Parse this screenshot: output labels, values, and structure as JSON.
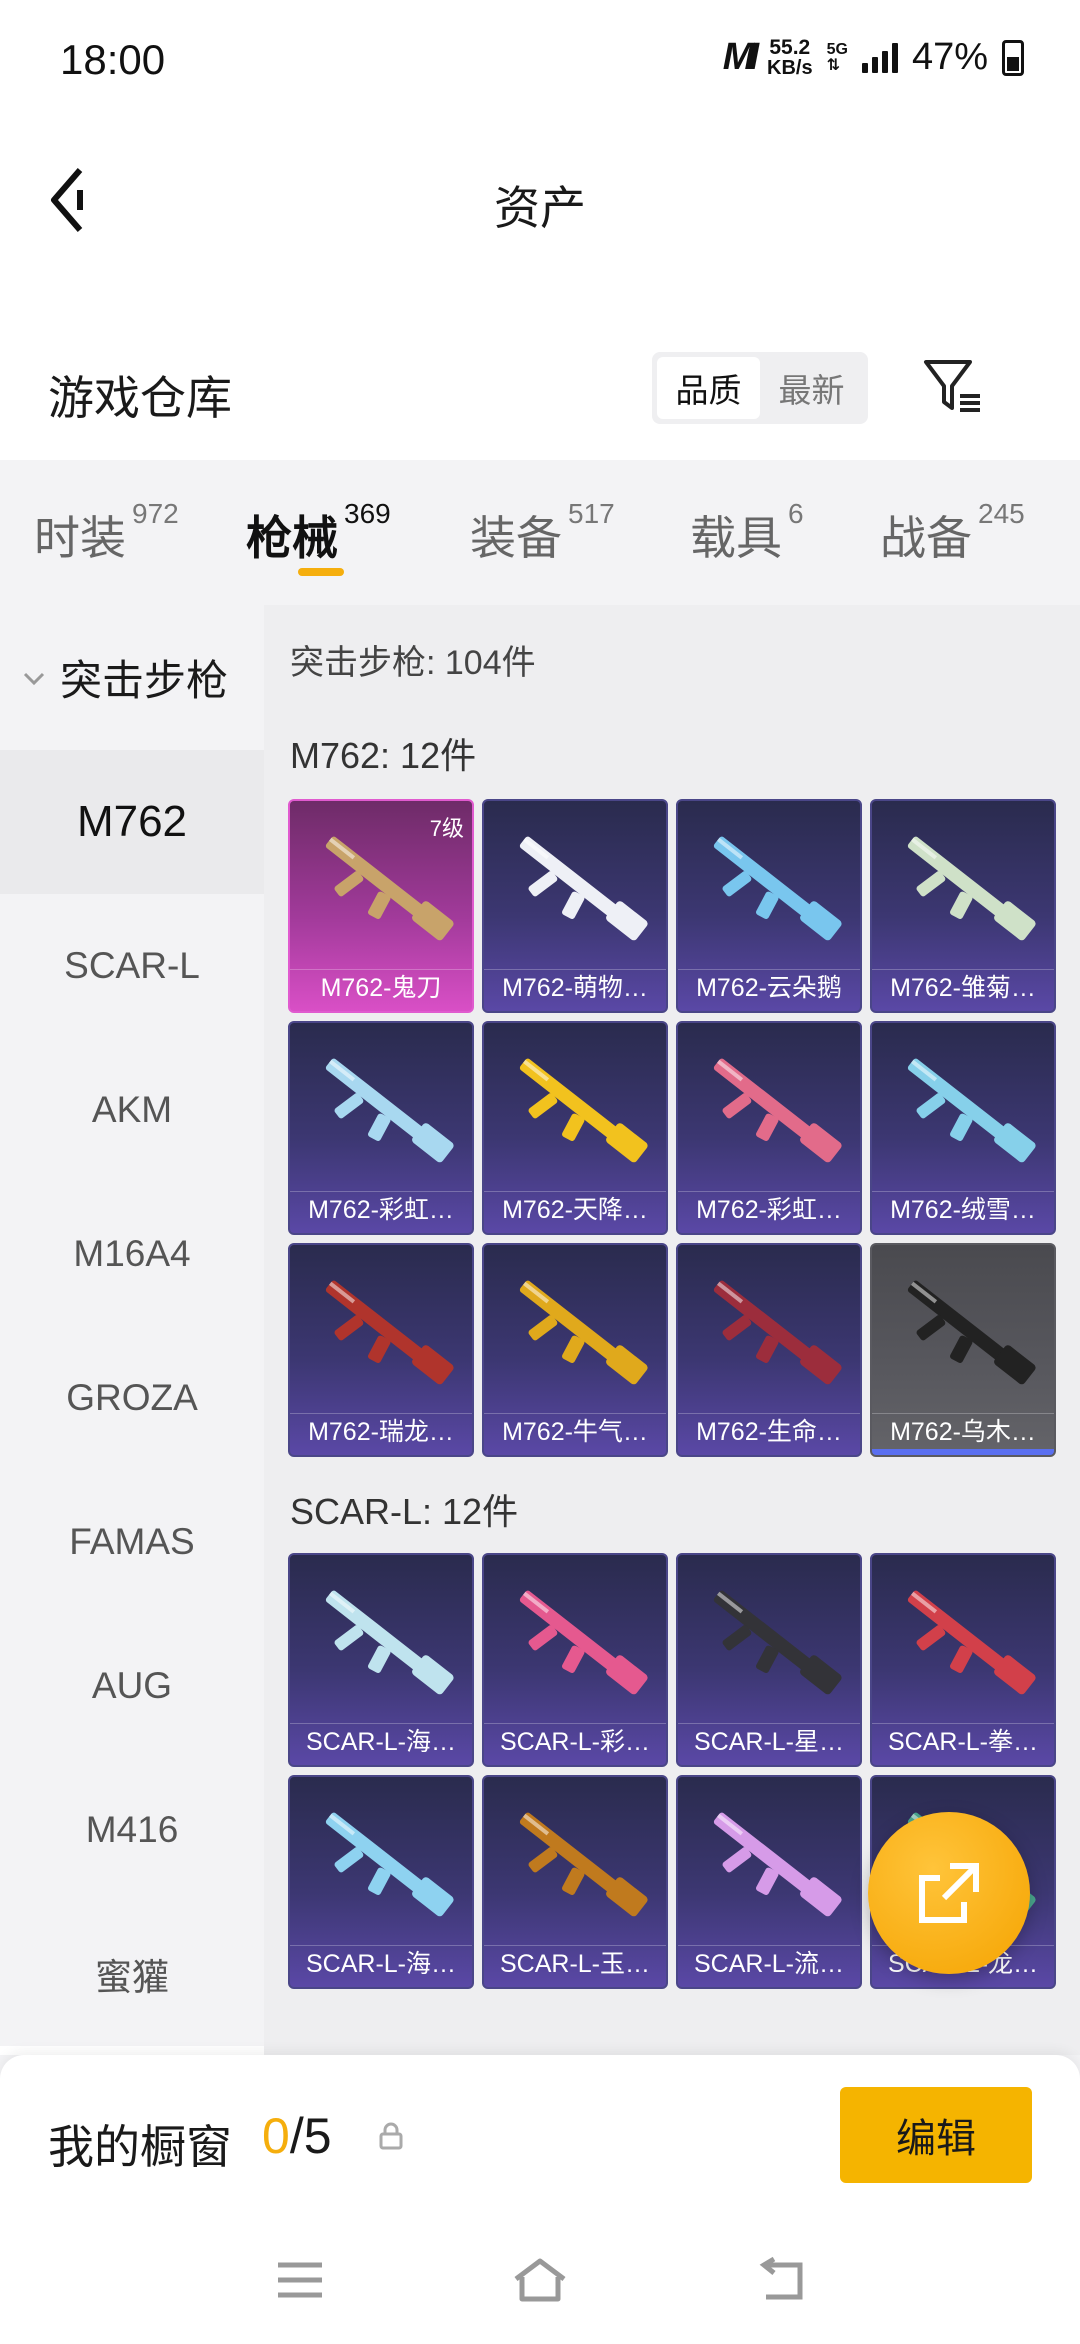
{
  "status_bar": {
    "time": "18:00",
    "network_speed": "55.2",
    "network_unit": "KB/s",
    "network_type": "5G",
    "battery": "47%"
  },
  "header": {
    "title": "资产"
  },
  "warehouse": {
    "title": "游戏仓库",
    "sort_options": [
      "品质",
      "最新"
    ],
    "selected_sort": "品质"
  },
  "tabs": [
    {
      "label": "时装",
      "count": "972"
    },
    {
      "label": "枪械",
      "count": "369",
      "active": true
    },
    {
      "label": "装备",
      "count": "517"
    },
    {
      "label": "载具",
      "count": "6"
    },
    {
      "label": "战备",
      "count": "245"
    }
  ],
  "sidebar": {
    "group": "突击步枪",
    "items": [
      "M762",
      "SCAR-L",
      "AKM",
      "M16A4",
      "GROZA",
      "FAMAS",
      "AUG",
      "M416",
      "蜜獾"
    ],
    "active": "M762"
  },
  "content": {
    "total": "突击步枪: 104件",
    "sections": [
      {
        "title": "M762: 12件",
        "items": [
          {
            "name": "M762-鬼刀",
            "level": "7级",
            "style": "gold",
            "color": "#c8a36a"
          },
          {
            "name": "M762-萌物…",
            "style": "normal",
            "color": "#eef0f6"
          },
          {
            "name": "M762-云朵鹅",
            "style": "normal",
            "color": "#79c6ee"
          },
          {
            "name": "M762-雏菊…",
            "style": "normal",
            "color": "#cfe1c8"
          },
          {
            "name": "M762-彩虹…",
            "style": "normal",
            "color": "#a8d8f0"
          },
          {
            "name": "M762-天降…",
            "style": "normal",
            "color": "#f2c21e"
          },
          {
            "name": "M762-彩虹…",
            "style": "normal",
            "color": "#e26b8a"
          },
          {
            "name": "M762-绒雪…",
            "style": "normal",
            "color": "#86d0ea"
          },
          {
            "name": "M762-瑞龙…",
            "style": "normal",
            "color": "#b0342c"
          },
          {
            "name": "M762-牛气…",
            "style": "normal",
            "color": "#e0a91c"
          },
          {
            "name": "M762-生命…",
            "style": "normal",
            "color": "#9c2d3c"
          },
          {
            "name": "M762-乌木…",
            "style": "grey",
            "color": "#222222"
          }
        ]
      },
      {
        "title": "SCAR-L: 12件",
        "items": [
          {
            "name": "SCAR-L-海…",
            "style": "normal",
            "color": "#bfe3ee"
          },
          {
            "name": "SCAR-L-彩…",
            "style": "normal",
            "color": "#e5598f"
          },
          {
            "name": "SCAR-L-星…",
            "style": "normal",
            "color": "#333338"
          },
          {
            "name": "SCAR-L-拳…",
            "style": "normal",
            "color": "#d2404a"
          },
          {
            "name": "SCAR-L-海…",
            "style": "normal",
            "color": "#8ed2f0"
          },
          {
            "name": "SCAR-L-玉…",
            "style": "normal",
            "color": "#c07a1e"
          },
          {
            "name": "SCAR-L-流…",
            "style": "normal",
            "color": "#d69be8"
          },
          {
            "name": "SCAR-L-龙…",
            "style": "normal",
            "color": "#4aa88e"
          }
        ]
      }
    ]
  },
  "showcase": {
    "label": "我的橱窗",
    "current": "0",
    "total": "/5",
    "edit_label": "编辑"
  },
  "colors": {
    "accent": "#f5ae0d",
    "card_normal": "#3c3772",
    "card_gold": "#a13a9a"
  }
}
